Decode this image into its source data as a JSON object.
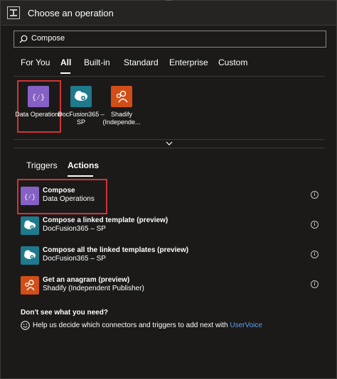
{
  "header": {
    "title": "Choose an operation",
    "icon": "connector-icon"
  },
  "search": {
    "value": "Compose",
    "icon": "search-icon"
  },
  "tabs": [
    {
      "label": "For You",
      "active": false
    },
    {
      "label": "All",
      "active": true
    },
    {
      "label": "Built-in",
      "active": false
    },
    {
      "label": "Standard",
      "active": false
    },
    {
      "label": "Enterprise",
      "active": false
    },
    {
      "label": "Custom",
      "active": false
    }
  ],
  "connectors": [
    {
      "label": "Data Operations",
      "color": "#8661c5",
      "icon": "data-operations-icon",
      "highlighted": true
    },
    {
      "label": "DocFusion365 – SP",
      "color": "#1e7a8c",
      "icon": "cloud-gear-icon",
      "highlighted": false
    },
    {
      "label": "Shadify (Independe...",
      "color": "#d24e17",
      "icon": "shadify-icon",
      "highlighted": false
    }
  ],
  "subtabs": [
    {
      "label": "Triggers",
      "active": false
    },
    {
      "label": "Actions",
      "active": true
    }
  ],
  "actions": [
    {
      "title": "Compose",
      "subtitle": "Data Operations",
      "color": "#8661c5",
      "icon": "data-operations-icon",
      "highlighted": true
    },
    {
      "title": "Compose a linked template (preview)",
      "subtitle": "DocFusion365 – SP",
      "color": "#1e7a8c",
      "icon": "cloud-gear-icon",
      "highlighted": false
    },
    {
      "title": "Compose all the linked templates (preview)",
      "subtitle": "DocFusion365 – SP",
      "color": "#1e7a8c",
      "icon": "cloud-gear-icon",
      "highlighted": false
    },
    {
      "title": "Get an anagram (preview)",
      "subtitle": "Shadify (Independent Publisher)",
      "color": "#d24e17",
      "icon": "shadify-icon",
      "highlighted": false
    }
  ],
  "footer": {
    "heading": "Don't see what you need?",
    "help_text": "Help us decide which connectors and triggers to add next with ",
    "link": "UserVoice"
  },
  "colors": {
    "highlight": "#d13438",
    "link": "#5ea0ef",
    "background": "#1b1a19"
  }
}
